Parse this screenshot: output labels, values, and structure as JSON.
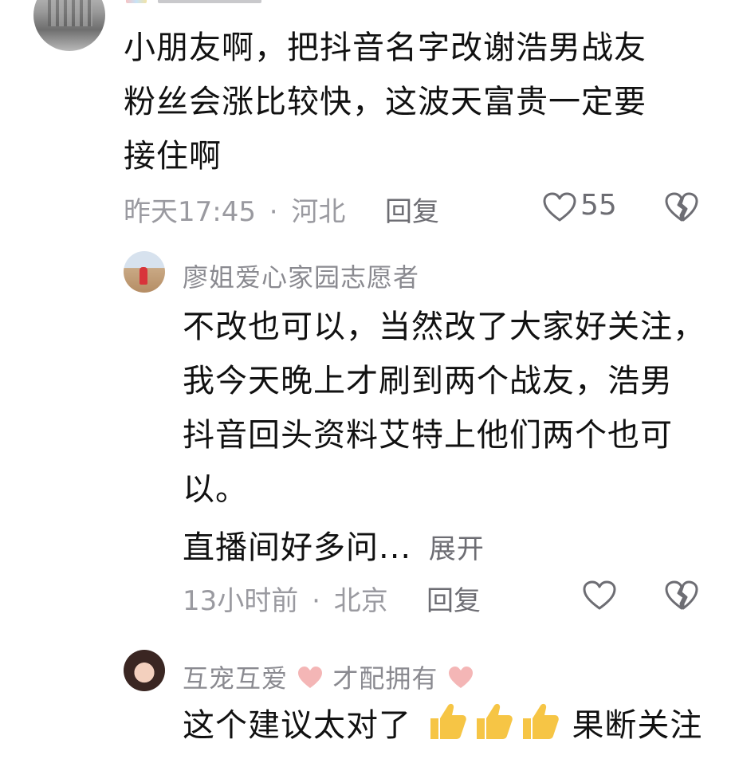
{
  "comments": [
    {
      "text_lines": [
        "小朋友啊，把抖音名字改谢浩男战友",
        "粉丝会涨比较快，这波天富贵一定要",
        "接住啊"
      ],
      "time": "昨天17:45",
      "sep": "·",
      "location": "河北",
      "reply_label": "回复",
      "like_count": "55"
    },
    {
      "nickname": "廖姐爱心家园志愿者",
      "text_lines": [
        "不改也可以，当然改了大家好关注，",
        "我今天晚上才刷到两个战友，浩男",
        "抖音回头资料艾特上他们两个也可",
        "以。"
      ],
      "preview_line": "直播间好多问...",
      "expand_label": "展开",
      "time": "13小时前",
      "sep": "·",
      "location": "北京",
      "reply_label": "回复"
    },
    {
      "nickname_part1": "互宠互爱",
      "nickname_part2": "才配拥有",
      "text_visible_start": "这个建议太对了",
      "text_visible_end": "果断关注"
    }
  ],
  "icons": {
    "like": "heart-outline-icon",
    "dislike": "broken-heart-icon",
    "emoji_heart": "pink-heart-emoji",
    "emoji_thumb": "thumbs-up-emoji"
  },
  "colors": {
    "text": "#111111",
    "meta": "#9a9aa0",
    "secondary": "#6d6d73",
    "emoji_heart": "#f4b6b6",
    "emoji_thumb": "#f6c545"
  }
}
